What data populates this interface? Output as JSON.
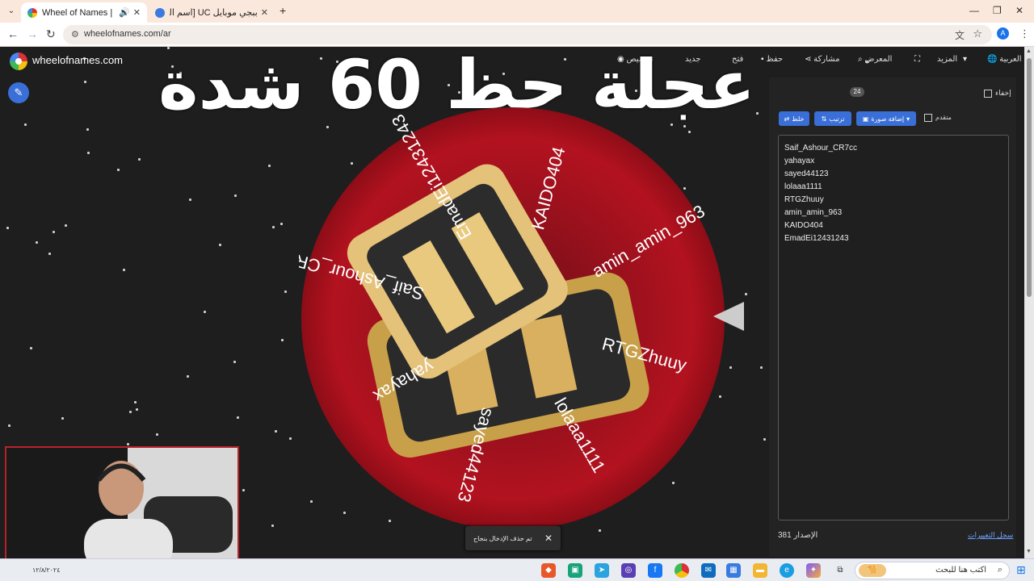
{
  "browser": {
    "tabs": [
      {
        "title": "Wheel of Names | العشوائي",
        "active": true
      },
      {
        "title": "ببجي موبايل UC [اسم الدولة] | خـ",
        "active": false
      }
    ],
    "url": "wheelofnames.com/ar",
    "profile_initial": "A"
  },
  "app": {
    "brand": "wheelofnames.com",
    "menu": [
      {
        "label": "العربية",
        "icon": "globe-icon"
      },
      {
        "label": "المزيد",
        "icon": "caret-down-icon"
      },
      {
        "label": "",
        "icon": "fullscreen-icon"
      },
      {
        "label": "المعرض",
        "icon": "search-icon"
      },
      {
        "label": "مشاركة",
        "icon": "share-icon"
      },
      {
        "label": "حفظ",
        "icon": "save-icon"
      },
      {
        "label": "فتح",
        "icon": "folder-icon"
      },
      {
        "label": "جديد",
        "icon": "new-file-icon"
      },
      {
        "label": "تخصيص",
        "icon": "palette-icon"
      }
    ],
    "headline": "عجلة حظ 60 شدة"
  },
  "wheel": {
    "accent": "#b3121f",
    "labels": [
      "KAIDO404",
      "amin_amin_963",
      "RTGZhuuy",
      "lolaaa1111",
      "sayed44123",
      "yahayax",
      "Saif_Ashour_CR7cc",
      "EmadEi12431243"
    ]
  },
  "sidebar": {
    "hide_label": "إخفاء",
    "count": "24",
    "buttons": {
      "shuffle": "خلط",
      "sort": "ترتيب",
      "add_image": "إضافة صورة"
    },
    "advanced_label": "متقدم",
    "entries": [
      "Saif_Ashour_CR7cc",
      "yahayax",
      "sayed44123",
      "lolaaa1111",
      "RTGZhuuy",
      "amin_amin_963",
      "KAIDO404",
      "EmadEi12431243"
    ],
    "version": "الإصدار 381",
    "changelog": "سجل التغييرات"
  },
  "toast": {
    "text": "تم حذف الإدخال بنجاح",
    "close": "✕"
  },
  "taskbar": {
    "search_placeholder": "اكتب هنا للبحث",
    "clock": "١٢/٨/٢٠٢٤"
  }
}
